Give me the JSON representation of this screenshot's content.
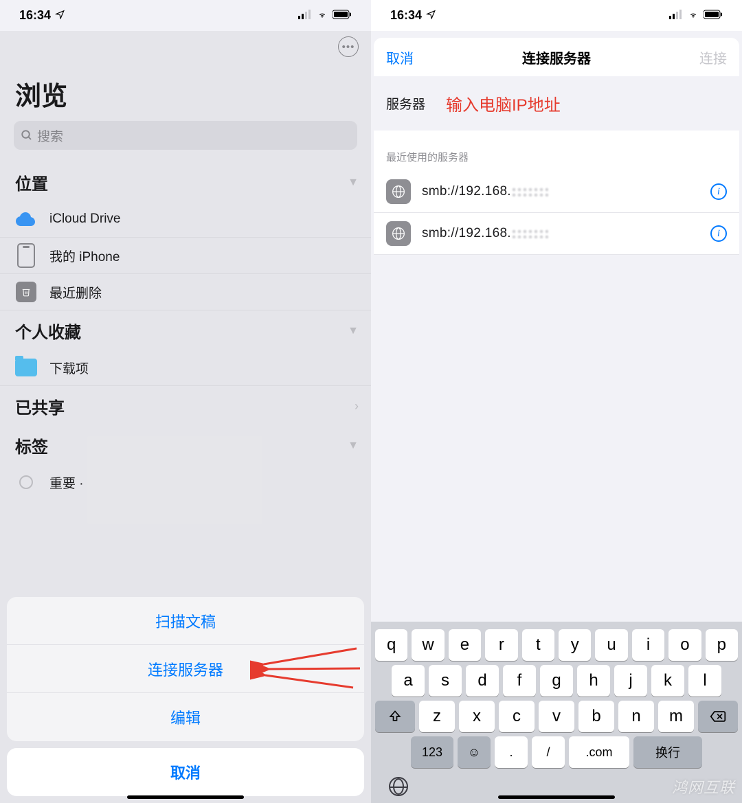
{
  "statusbar": {
    "time": "16:34"
  },
  "left": {
    "title": "浏览",
    "search_placeholder": "搜索",
    "sections": {
      "locations": {
        "label": "位置",
        "items": [
          {
            "label": "iCloud Drive"
          },
          {
            "label": "我的 iPhone"
          },
          {
            "label": "最近删除"
          }
        ]
      },
      "favorites": {
        "label": "个人收藏",
        "items": [
          {
            "label": "下载项"
          }
        ]
      },
      "shared": {
        "label": "已共享"
      },
      "tags": {
        "label": "标签",
        "items": [
          {
            "label": "重要 ·"
          }
        ]
      }
    },
    "sheet": {
      "scan": "扫描文稿",
      "connect": "连接服务器",
      "edit": "编辑",
      "cancel": "取消"
    }
  },
  "right": {
    "modal": {
      "cancel": "取消",
      "title": "连接服务器",
      "connect": "连接",
      "server_label": "服务器",
      "annotation": "输入电脑IP地址",
      "recent_label": "最近使用的服务器",
      "servers": [
        {
          "text": "smb://192.168."
        },
        {
          "text": "smb://192.168."
        }
      ]
    },
    "keyboard": {
      "row1": [
        "q",
        "w",
        "e",
        "r",
        "t",
        "y",
        "u",
        "i",
        "o",
        "p"
      ],
      "row2": [
        "a",
        "s",
        "d",
        "f",
        "g",
        "h",
        "j",
        "k",
        "l"
      ],
      "row3": [
        "z",
        "x",
        "c",
        "v",
        "b",
        "n",
        "m"
      ],
      "num": "123",
      "dot": ".",
      "slash": "/",
      "com": ".com",
      "return": "换行"
    }
  },
  "watermark": "鸿网互联"
}
